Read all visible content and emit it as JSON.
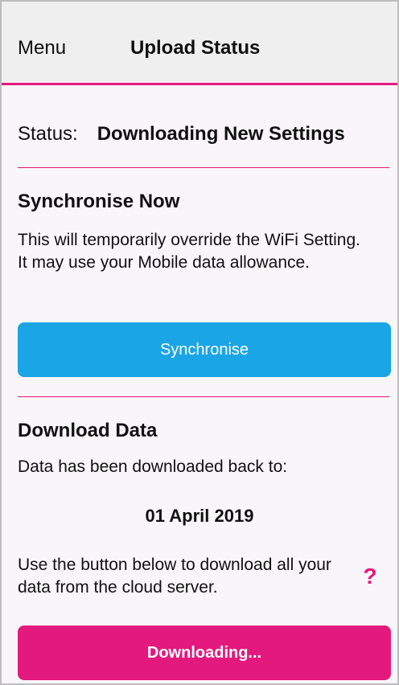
{
  "navbar": {
    "menu_label": "Menu",
    "title": "Upload Status"
  },
  "status": {
    "label": "Status:",
    "value": "Downloading New Settings"
  },
  "sync_section": {
    "title": "Synchronise Now",
    "description": "This will temporarily override the WiFi Setting.  It may use your Mobile data allowance.",
    "button_label": "Synchronise"
  },
  "download_section": {
    "title": "Download Data",
    "info": "Data has been downloaded back to:",
    "date": "01 April 2019",
    "hint": "Use the button below to download all your data from the cloud server.",
    "help_icon_glyph": "?",
    "button_label": "Downloading..."
  },
  "colors": {
    "accent": "#e4197e",
    "sync_button": "#1aa5e6",
    "navbar_bg": "#f0eff0",
    "page_bg": "#f8f6f8"
  }
}
